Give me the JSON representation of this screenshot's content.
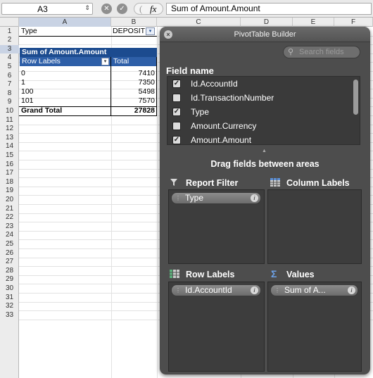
{
  "formula_bar": {
    "name_box": "A3",
    "stepper": "⇕",
    "cancel_icon": "✕",
    "enter_icon": "✓",
    "paren": "(",
    "fx_label": "fx",
    "formula": "Sum of Amount.Amount"
  },
  "columns": [
    "A",
    "B",
    "C",
    "D",
    "E",
    "F"
  ],
  "rows": [
    "1",
    "2",
    "3",
    "4",
    "5",
    "6",
    "7",
    "8",
    "9",
    "10",
    "11",
    "12",
    "13",
    "14",
    "15",
    "16",
    "17",
    "18",
    "19",
    "20",
    "21",
    "22",
    "23",
    "24",
    "25",
    "26",
    "27",
    "28",
    "29",
    "30",
    "31",
    "32",
    "33"
  ],
  "pivot": {
    "filter_label": "Type",
    "filter_value": "DEPOSIT",
    "filter_icon": "▾",
    "value_header": "Sum of Amount.Amount",
    "row_labels_header": "Row Labels",
    "row_labels_dropdown": "▾",
    "total_header": "Total",
    "rows": [
      {
        "label": "0",
        "value": "7410"
      },
      {
        "label": "1",
        "value": "7350"
      },
      {
        "label": "100",
        "value": "5498"
      },
      {
        "label": "101",
        "value": "7570"
      }
    ],
    "grand_total_label": "Grand Total",
    "grand_total_value": "27828"
  },
  "builder": {
    "title": "PivotTable Builder",
    "close_icon": "×",
    "search_placeholder": "Search fields",
    "field_name_label": "Field name",
    "fields": [
      {
        "name": "Id.AccountId",
        "checked": true
      },
      {
        "name": "Id.TransactionNumber",
        "checked": false
      },
      {
        "name": "Type",
        "checked": true
      },
      {
        "name": "Amount.Currency",
        "checked": false
      },
      {
        "name": "Amount.Amount",
        "checked": true
      }
    ],
    "drag_hint": "Drag fields between areas",
    "areas": {
      "report_filter": {
        "title": "Report Filter",
        "icon": "filter-icon",
        "items": [
          "Type"
        ]
      },
      "column_labels": {
        "title": "Column Labels",
        "icon": "column-labels-icon",
        "items": []
      },
      "row_labels": {
        "title": "Row Labels",
        "icon": "row-labels-icon",
        "items": [
          "Id.AccountId"
        ]
      },
      "values": {
        "title": "Values",
        "icon": "sigma-icon",
        "items": [
          "Sum of A..."
        ]
      }
    }
  }
}
